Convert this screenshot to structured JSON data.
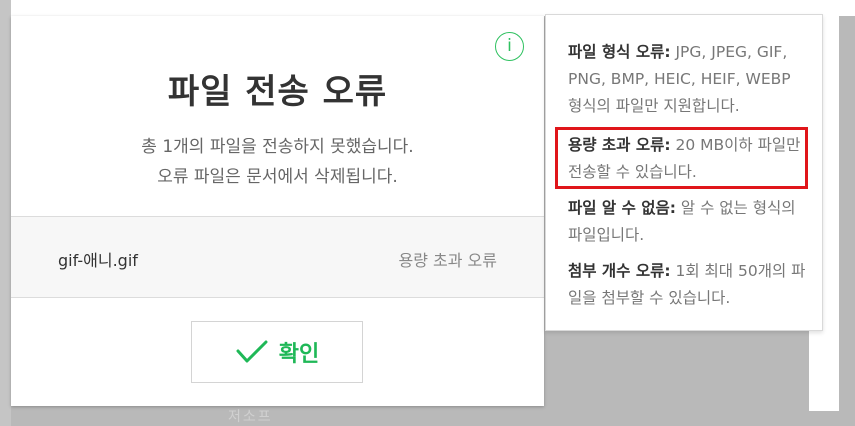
{
  "background": {
    "text": "저소프"
  },
  "dialog": {
    "title": "파일 전송 오류",
    "description_line1": "총 1개의 파일을 전송하지 못했습니다.",
    "description_line2": "오류 파일은 문서에서 삭제됩니다.",
    "info_button_label": "i",
    "file": {
      "name": "gif-애니.gif",
      "status": "용량 초과 오류"
    },
    "confirm_label": "확인",
    "accent_color": "#1fb857"
  },
  "info_panel": {
    "items": [
      {
        "label": "파일 형식 오류:",
        "text": " JPG, JPEG, GIF, PNG, BMP, HEIC, HEIF, WEBP 형식의 파일만 지원합니다."
      },
      {
        "label": "용량 초과 오류:",
        "text": " 20 MB이하 파일만 전송할 수 있습니다."
      },
      {
        "label": "파일 알 수 없음:",
        "text": " 알 수 없는 형식의 파일입니다."
      },
      {
        "label": "첨부 개수 오류:",
        "text": " 1회 최대 50개의 파일을 첨부할 수 있습니다."
      }
    ],
    "highlight_color": "#e0151a"
  }
}
